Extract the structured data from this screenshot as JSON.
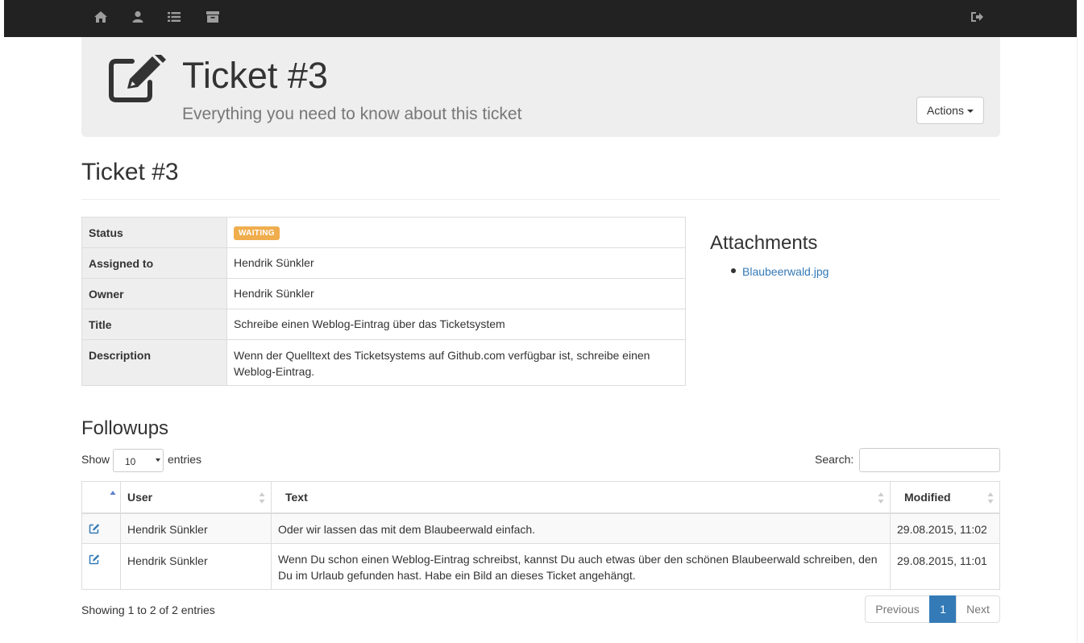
{
  "navbar": {
    "icons": [
      "home-icon",
      "user-icon",
      "list-icon",
      "archive-icon",
      "sign-out-icon"
    ]
  },
  "header": {
    "title": "Ticket #3",
    "subtitle": "Everything you need to know about this ticket",
    "actions_label": "Actions"
  },
  "page": {
    "heading": "Ticket #3"
  },
  "details": {
    "rows": [
      {
        "label": "Status",
        "value": "WAITING"
      },
      {
        "label": "Assigned to",
        "value": "Hendrik Sünkler"
      },
      {
        "label": "Owner",
        "value": "Hendrik Sünkler"
      },
      {
        "label": "Title",
        "value": "Schreibe einen Weblog-Eintrag über das Ticketsystem"
      },
      {
        "label": "Description",
        "value": "Wenn der Quelltext des Ticketsystems auf Github.com verfügbar ist, schreibe einen Weblog-Eintrag."
      }
    ],
    "status_color": "#f0ad4e"
  },
  "attachments": {
    "heading": "Attachments",
    "items": [
      "Blaubeerwald.jpg"
    ]
  },
  "followups": {
    "heading": "Followups",
    "show_label": "Show",
    "show_value": "10",
    "entries_label": "entries",
    "search_label": "Search:",
    "search_value": "",
    "columns": [
      "",
      "User",
      "Text",
      "Modified"
    ],
    "rows": [
      {
        "user": "Hendrik Sünkler",
        "text": "Oder wir lassen das mit dem Blaubeerwald einfach.",
        "modified": "29.08.2015, 11:02"
      },
      {
        "user": "Hendrik Sünkler",
        "text": "Wenn Du schon einen Weblog-Eintrag schreibst, kannst Du auch etwas über den schönen Blaubeerwald schreiben, den Du im Urlaub gefunden hast. Habe ein Bild an dieses Ticket angehängt.",
        "modified": "29.08.2015, 11:01"
      }
    ],
    "info": "Showing 1 to 2 of 2 entries",
    "pager": {
      "previous": "Previous",
      "current": "1",
      "next": "Next"
    }
  },
  "colors": {
    "navbar_bg": "#222222",
    "jumbotron_bg": "#eeeeee",
    "link": "#337ab7",
    "primary": "#337ab7",
    "warning": "#f0ad4e"
  }
}
